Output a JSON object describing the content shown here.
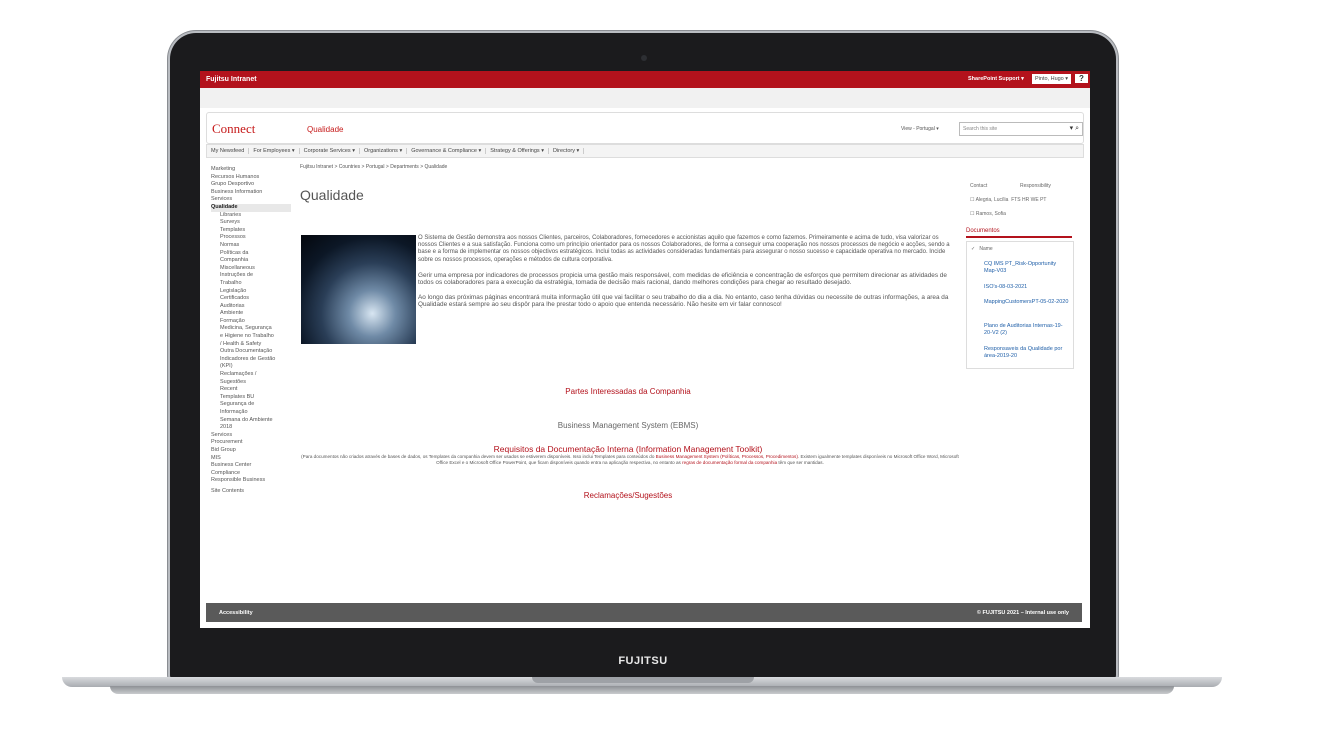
{
  "topbar": {
    "intranet": "Fujitsu Intranet",
    "support": "SharePoint Support ▾",
    "user": "Pinto, Hugo ▾",
    "help": "?"
  },
  "header": {
    "logo": "Connect",
    "site_title": "Qualidade",
    "view": "View - Portugal",
    "search_placeholder": "Search this site"
  },
  "nav": [
    "My Newsfeed",
    "For Employees ▾",
    "Corporate Services ▾",
    "Organizations ▾",
    "Governance & Compliance ▾",
    "Strategy & Offerings ▾",
    "Directory ▾"
  ],
  "breadcrumb": "Fujitsu Intranet > Countries > Portugal > Departments > Qualidade",
  "sidebar": {
    "items": [
      {
        "label": "Marketing",
        "level": 0
      },
      {
        "label": "Recursos Humanos",
        "level": 0
      },
      {
        "label": "Grupo Desportivo",
        "level": 0
      },
      {
        "label": "Business Information",
        "level": 0
      },
      {
        "label": "Services",
        "level": 0
      },
      {
        "label": "Qualidade",
        "level": 0,
        "selected": true
      },
      {
        "label": "Libraries",
        "level": 1
      },
      {
        "label": "Surveys",
        "level": 1
      },
      {
        "label": "Templates",
        "level": 1
      },
      {
        "label": "Processos",
        "level": 1
      },
      {
        "label": "Normas",
        "level": 1
      },
      {
        "label": "Políticas da",
        "level": 1
      },
      {
        "label": "Companhia",
        "level": 1
      },
      {
        "label": "Miscellaneous",
        "level": 1
      },
      {
        "label": "Instruções de",
        "level": 1
      },
      {
        "label": "Trabalho",
        "level": 1
      },
      {
        "label": "Legislação",
        "level": 1
      },
      {
        "label": "Certificados",
        "level": 1
      },
      {
        "label": "Auditorias",
        "level": 1
      },
      {
        "label": "Ambiente",
        "level": 1
      },
      {
        "label": "Formação",
        "level": 1
      },
      {
        "label": "Medicina, Segurança",
        "level": 1
      },
      {
        "label": "e Higiene no Trabalho",
        "level": 1
      },
      {
        "label": "/ Health & Safety",
        "level": 1
      },
      {
        "label": "Outra Documentação",
        "level": 1
      },
      {
        "label": "Indicadores de Gestão",
        "level": 1
      },
      {
        "label": "(KPI)",
        "level": 1
      },
      {
        "label": "Reclamações /",
        "level": 1
      },
      {
        "label": "Sugestões",
        "level": 1
      },
      {
        "label": "Recent",
        "level": 1
      },
      {
        "label": "Templates BU",
        "level": 1
      },
      {
        "label": "Segurança de",
        "level": 1
      },
      {
        "label": "Informação",
        "level": 1
      },
      {
        "label": "Semana do Ambiente",
        "level": 1
      },
      {
        "label": "2018",
        "level": 1
      },
      {
        "label": "Services",
        "level": 0
      },
      {
        "label": "Procurement",
        "level": 0
      },
      {
        "label": "Bid Group",
        "level": 0
      },
      {
        "label": "MIS",
        "level": 0
      },
      {
        "label": "Business Center",
        "level": 0
      },
      {
        "label": "Compliance",
        "level": 0
      },
      {
        "label": "Responsible Business",
        "level": 0
      },
      {
        "label": "Site Contents",
        "level": 0
      }
    ]
  },
  "page_title": "Qualidade",
  "body": {
    "p1": "O Sistema de Gestão demonstra aos nossos Clientes, parceiros, Colaboradores, fornecedores e accionistas aquilo que fazemos e como fazemos. Primeiramente e acima de tudo, visa valorizar os nossos Clientes e a sua satisfação. Funciona como um princípio orientador para os nossos Colaboradores, de forma a conseguir uma cooperação nos nossos processos de negócio e acções, sendo a base e a forma de implementar os nossos objectivos estratégicos. Inclui todas as actividades consideradas fundamentais para assegurar o nosso sucesso e capacidade operativa no mercado. Incide sobre os nossos processos, operações e métodos de cultura corporativa.",
    "p2": "Gerir uma empresa por indicadores de processos propicia uma gestão mais responsável, com medidas de eficiência e concentração de esforços que permitem direcionar as atividades de todos os colaboradores para a execução da estratégia, tomada de decisão mais racional, dando melhores condições para chegar ao resultado desejado.",
    "p3": "Ao longo das próximas páginas encontrará muita informação útil que vai facilitar o seu trabalho do dia a dia. No entanto, caso tenha dúvidas ou necessite de outras informações, a area da Qualidade estará sempre ao seu dispôr para lhe prestar todo o apoio que entenda necessário. Não hesite em vir falar connosco!"
  },
  "links": {
    "partes": "Partes Interessadas da Companhia",
    "ebms": "Business Management System (EBMS)",
    "requisitos": "Requisitos da Documentação Interna (Information Management Toolkit)",
    "reclamacoes": "Reclamações/Sugestões"
  },
  "note": {
    "a": "(Para documentos não criados através de bases de dados, os Templates da companhia devem ser usados se estiverem disponíveis. Isso inclui Templates para conteúdos do ",
    "b": "Business Management System (Políticas, Processos, Procedimentos)",
    "c": ". Existem igualmente templates disponíveis no Microsoft Office Word, Microsoft Office Excel e o Microsoft Office PowerPoint, que ficam disponíveis quando entra na aplicação respectiva, no entanto as ",
    "d": "regras de documentação formal da companhia",
    "e": " têm que ser mantidas."
  },
  "contacts": {
    "col1": "Contact",
    "col2": "Responsibility",
    "rows": [
      {
        "name": "Alegria, Lucília",
        "resp": "FTS HR WE PT"
      },
      {
        "name": "Ramos, Sofia",
        "resp": ""
      }
    ]
  },
  "documents": {
    "title": "Documentos",
    "header": "Name",
    "items": [
      "CQ IMS PT_Risk-Opportunity Map-V03",
      "ISO's-08-03-2021",
      "MappingCustomersPT-05-02-2020",
      "Plano de Auditorias Internas-19-20-V2 (2)",
      "Responsaveis da Qualidade por área-2019-20"
    ]
  },
  "footer": {
    "left": "Accessibility",
    "right": "© FUJITSU 2021 – Internal use only"
  },
  "laptop": {
    "brand": "FUJITSU"
  }
}
